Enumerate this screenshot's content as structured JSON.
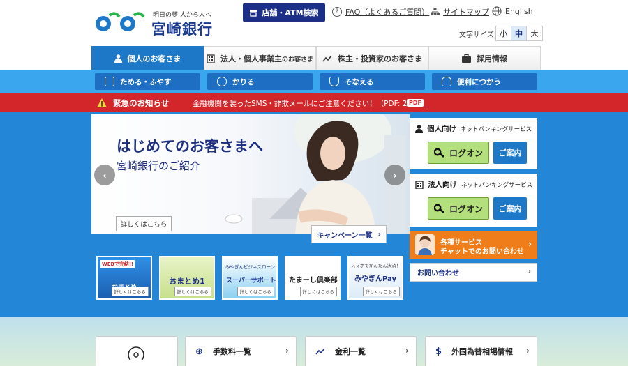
{
  "header": {
    "logo_tagline": "明日の夢 人から人へ",
    "logo_name": "宮崎銀行",
    "store_button": "店舗・ATM検索",
    "faq_link": "FAQ（よくあるご質問）",
    "sitemap_link": "サイトマップ",
    "english_link": "English",
    "font_size_label": "文字サイズ",
    "font_sizes": [
      "小",
      "中",
      "大"
    ],
    "font_size_selected": "中"
  },
  "main_tabs": [
    {
      "label": "個人のお客さま",
      "small": ""
    },
    {
      "label": "法人・個人事業主",
      "small": "のお客さま"
    },
    {
      "label": "株主・投資家のお客さま",
      "small": ""
    },
    {
      "label": "採用情報",
      "small": ""
    }
  ],
  "sub_nav": [
    "ためる・ふやす",
    "かりる",
    "そなえる",
    "便利につかう"
  ],
  "alert": {
    "title": "緊急のお知らせ",
    "link": "金融機関を装ったSMS・詐欺メールにご注意ください！（PDF: 27KB）",
    "badge": "PDF"
  },
  "hero": {
    "title": "はじめてのお客さまへ",
    "subtitle": "宮崎銀行のご紹介",
    "detail_button": "詳しくはこちら",
    "prev": "‹",
    "next": "›",
    "campaign_button": "キャンペーン一覧"
  },
  "netbanking": [
    {
      "title": "個人向け",
      "note": "ネットバンキングサービス",
      "logon": "ログオン",
      "guide": "ご案内"
    },
    {
      "title": "法人向け",
      "note": "ネットバンキングサービス",
      "logon": "ログオン",
      "guide": "ご案内"
    }
  ],
  "chat": {
    "line1": "各種サービス",
    "line2": "チャットでのお問い合わせ"
  },
  "inquiry": "お問い合わせ",
  "promos": [
    {
      "label": "おまとめ",
      "top": "WEBで完結!!",
      "button": "詳しくはこちら"
    },
    {
      "label": "おまとめ1",
      "top": "",
      "button": "詳しくはこちら"
    },
    {
      "label": "スーパーサポート",
      "top": "みやぎんビジネスローン",
      "button": "詳しくはこちら"
    },
    {
      "label": "たまーし倶楽部",
      "top": "",
      "button": "詳しくはこちら"
    },
    {
      "label": "みやぎんPay",
      "top": "スマホでかんたん決済！",
      "button": "詳しくはこちら"
    }
  ],
  "bottom_links": [
    "手数料一覧",
    "金利一覧",
    "外国為替相場情報"
  ],
  "colors": {
    "brand_navy": "#1b2f86",
    "tab_blue": "#1e78c8",
    "band_blue": "#3aa6ee",
    "content_blue": "#2486d6",
    "alert_red": "#d2262b",
    "logon_green": "#b3e07d",
    "chat_orange": "#ef7d1a"
  }
}
